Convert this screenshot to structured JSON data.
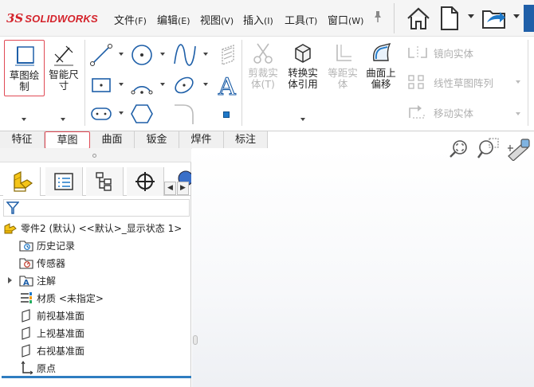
{
  "app": {
    "logo_mark": "3S",
    "logo_text": "SOLIDWORKS"
  },
  "menu": [
    {
      "label": "文件",
      "accel": "(F)"
    },
    {
      "label": "编辑",
      "accel": "(E)"
    },
    {
      "label": "视图",
      "accel": "(V)"
    },
    {
      "label": "插入",
      "accel": "(I)"
    },
    {
      "label": "工具",
      "accel": "(T)"
    },
    {
      "label": "窗口",
      "accel": "(W)"
    }
  ],
  "quick_access": [
    "home-icon",
    "new-document-icon",
    "open-file-icon"
  ],
  "ribbon": {
    "sketch": {
      "line1": "草图绘",
      "line2": "制"
    },
    "smart_dim": {
      "line1": "智能尺",
      "line2": "寸"
    },
    "trim": {
      "line1": "剪裁实",
      "line2": "体(T)"
    },
    "convert": {
      "line1": "转换实",
      "line2": "体引用"
    },
    "offset": {
      "line1": "等距实",
      "line2": "体"
    },
    "surface_offset": {
      "line1": "曲面上",
      "line2": "偏移"
    },
    "mirror": "镜向实体",
    "linear_pattern": "线性草图阵列",
    "move": "移动实体"
  },
  "tabs": [
    "特征",
    "草图",
    "曲面",
    "钣金",
    "焊件",
    "标注"
  ],
  "active_tab": "草图",
  "tree": {
    "root": "零件2 (默认) <<默认>_显示状态 1>",
    "items": [
      "历史记录",
      "传感器",
      "注解",
      "材质 <未指定>",
      "前视基准面",
      "上视基准面",
      "右视基准面",
      "原点"
    ]
  },
  "colors": {
    "accent": "#e04a55",
    "brand": "#d4232b",
    "selection": "#2f7dc1"
  }
}
